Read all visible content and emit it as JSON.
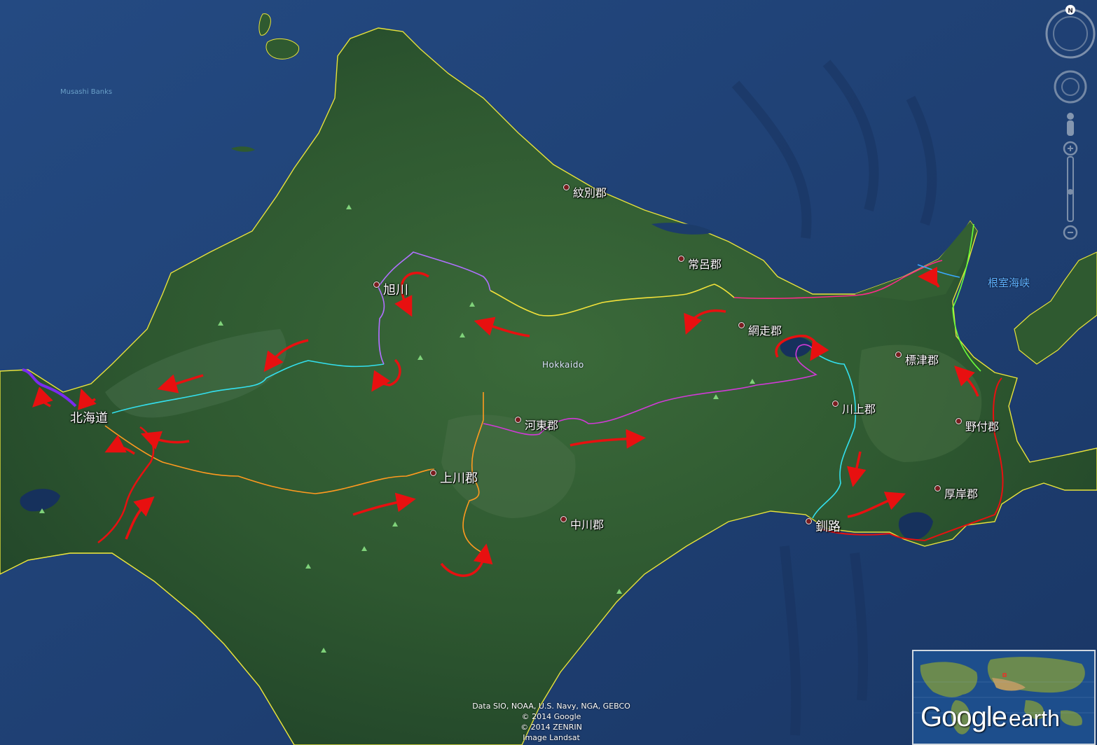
{
  "map": {
    "places": {
      "monbetsu": "紋別郡",
      "tokoro": "常呂郡",
      "asahikawa": "旭川",
      "abashiri": "網走郡",
      "shibetsu": "標津郡",
      "kawakami": "川上郡",
      "notsuke": "野付郡",
      "hokkaido": "北海道",
      "kato": "河東郡",
      "kamikawa": "上川郡",
      "akkeshi": "厚岸郡",
      "nakagawa": "中川郡",
      "kushiro": "釧路"
    },
    "sea_labels": {
      "nemuro_strait": "根室海峡",
      "musashi_bank": "Musashi Banks"
    },
    "region_label": "Hokkaido",
    "colors": {
      "ocean": "#1d3f73",
      "land": "#2f5a30",
      "coastline": "#e8e23a",
      "route_annotation": "#e81010",
      "route_cyan": "#33e0ee",
      "route_orange": "#ff9a1f",
      "route_yellow": "#f3e23a",
      "route_violet": "#b070ff",
      "route_magenta": "#d23ad8",
      "route_pink": "#ff2a8a",
      "route_purple": "#7a2bf0"
    }
  },
  "attribution": {
    "line1": "Data SIO, NOAA, U.S. Navy, NGA, GEBCO",
    "line2": "© 2014 Google",
    "line3": "© 2014 ZENRIN",
    "line4": "Image Landsat"
  },
  "navigation": {
    "north_label": "N",
    "icons": [
      "compass-ring-icon",
      "look-joystick-icon",
      "street-view-pegman-icon",
      "zoom-slider-icon"
    ]
  },
  "overview": {
    "logo_word1": "Google",
    "logo_word2": "earth"
  }
}
